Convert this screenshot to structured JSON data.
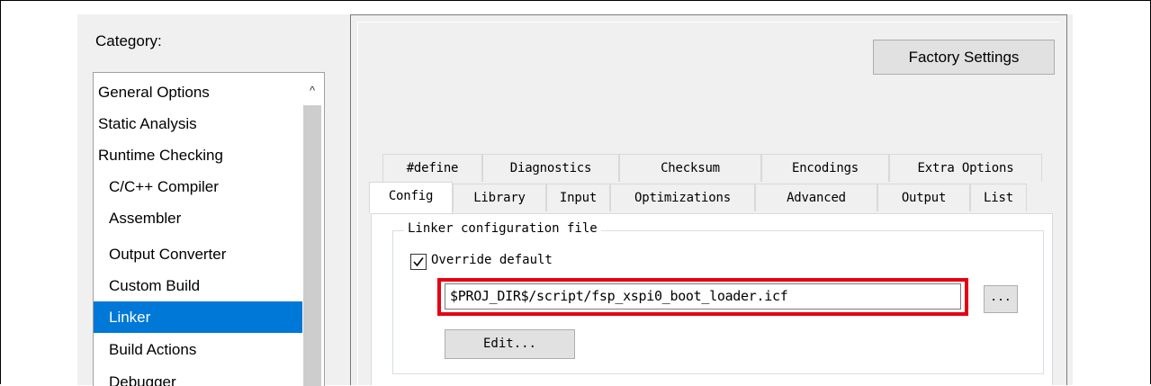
{
  "category_label": "Category:",
  "categories": [
    {
      "label": "General Options"
    },
    {
      "label": "Static Analysis"
    },
    {
      "label": "Runtime Checking"
    },
    {
      "label": "C/C++ Compiler"
    },
    {
      "label": "Assembler"
    },
    {
      "label": "Output Converter"
    },
    {
      "label": "Custom Build"
    },
    {
      "label": "Linker"
    },
    {
      "label": "Build Actions"
    },
    {
      "label": "Debugger"
    }
  ],
  "scroll_up_glyph": "^",
  "factory_settings_label": "Factory Settings",
  "tabs_row1": [
    {
      "label": "#define"
    },
    {
      "label": "Diagnostics"
    },
    {
      "label": "Checksum"
    },
    {
      "label": "Encodings"
    },
    {
      "label": "Extra Options"
    }
  ],
  "tabs_row2": [
    {
      "label": "Config"
    },
    {
      "label": "Library"
    },
    {
      "label": "Input"
    },
    {
      "label": "Optimizations"
    },
    {
      "label": "Advanced"
    },
    {
      "label": "Output"
    },
    {
      "label": "List"
    }
  ],
  "group_title": "Linker configuration file",
  "override_label": "Override default",
  "override_checked": true,
  "config_path": "$PROJ_DIR$/script/fsp_xspi0_boot_loader.icf",
  "browse_label": "...",
  "edit_label": "Edit...",
  "colors": {
    "selection": "#0078d7",
    "highlight_box": "#e60012"
  }
}
